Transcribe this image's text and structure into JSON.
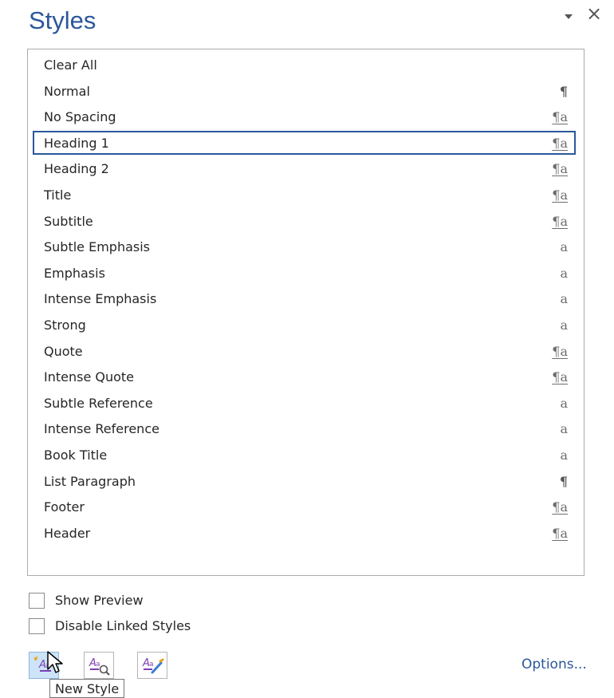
{
  "pane": {
    "title": "Styles"
  },
  "styles": [
    {
      "name": "Clear All",
      "type": ""
    },
    {
      "name": "Normal",
      "type": "¶",
      "kind": "para"
    },
    {
      "name": "No Spacing",
      "type": "¶a",
      "kind": "linked"
    },
    {
      "name": "Heading 1",
      "type": "¶a",
      "kind": "linked",
      "selected": true
    },
    {
      "name": "Heading 2",
      "type": "¶a",
      "kind": "linked"
    },
    {
      "name": "Title",
      "type": "¶a",
      "kind": "linked"
    },
    {
      "name": "Subtitle",
      "type": "¶a",
      "kind": "linked"
    },
    {
      "name": "Subtle Emphasis",
      "type": "a",
      "kind": "char"
    },
    {
      "name": "Emphasis",
      "type": "a",
      "kind": "char"
    },
    {
      "name": "Intense Emphasis",
      "type": "a",
      "kind": "char"
    },
    {
      "name": "Strong",
      "type": "a",
      "kind": "char"
    },
    {
      "name": "Quote",
      "type": "¶a",
      "kind": "linked"
    },
    {
      "name": "Intense Quote",
      "type": "¶a",
      "kind": "linked"
    },
    {
      "name": "Subtle Reference",
      "type": "a",
      "kind": "char"
    },
    {
      "name": "Intense Reference",
      "type": "a",
      "kind": "char"
    },
    {
      "name": "Book Title",
      "type": "a",
      "kind": "char"
    },
    {
      "name": "List Paragraph",
      "type": "¶",
      "kind": "para"
    },
    {
      "name": "Footer",
      "type": "¶a",
      "kind": "linked"
    },
    {
      "name": "Header",
      "type": "¶a",
      "kind": "linked"
    }
  ],
  "options": {
    "show_preview": "Show Preview",
    "disable_linked": "Disable Linked Styles",
    "options_link": "Options..."
  },
  "tooltip": {
    "text": "New Style"
  },
  "icons": {
    "new_style": "new-style-icon",
    "style_inspector": "style-inspector-icon",
    "manage_styles": "manage-styles-icon"
  },
  "colors": {
    "accent": "#2b579a",
    "active_button": "#cde3f7"
  }
}
